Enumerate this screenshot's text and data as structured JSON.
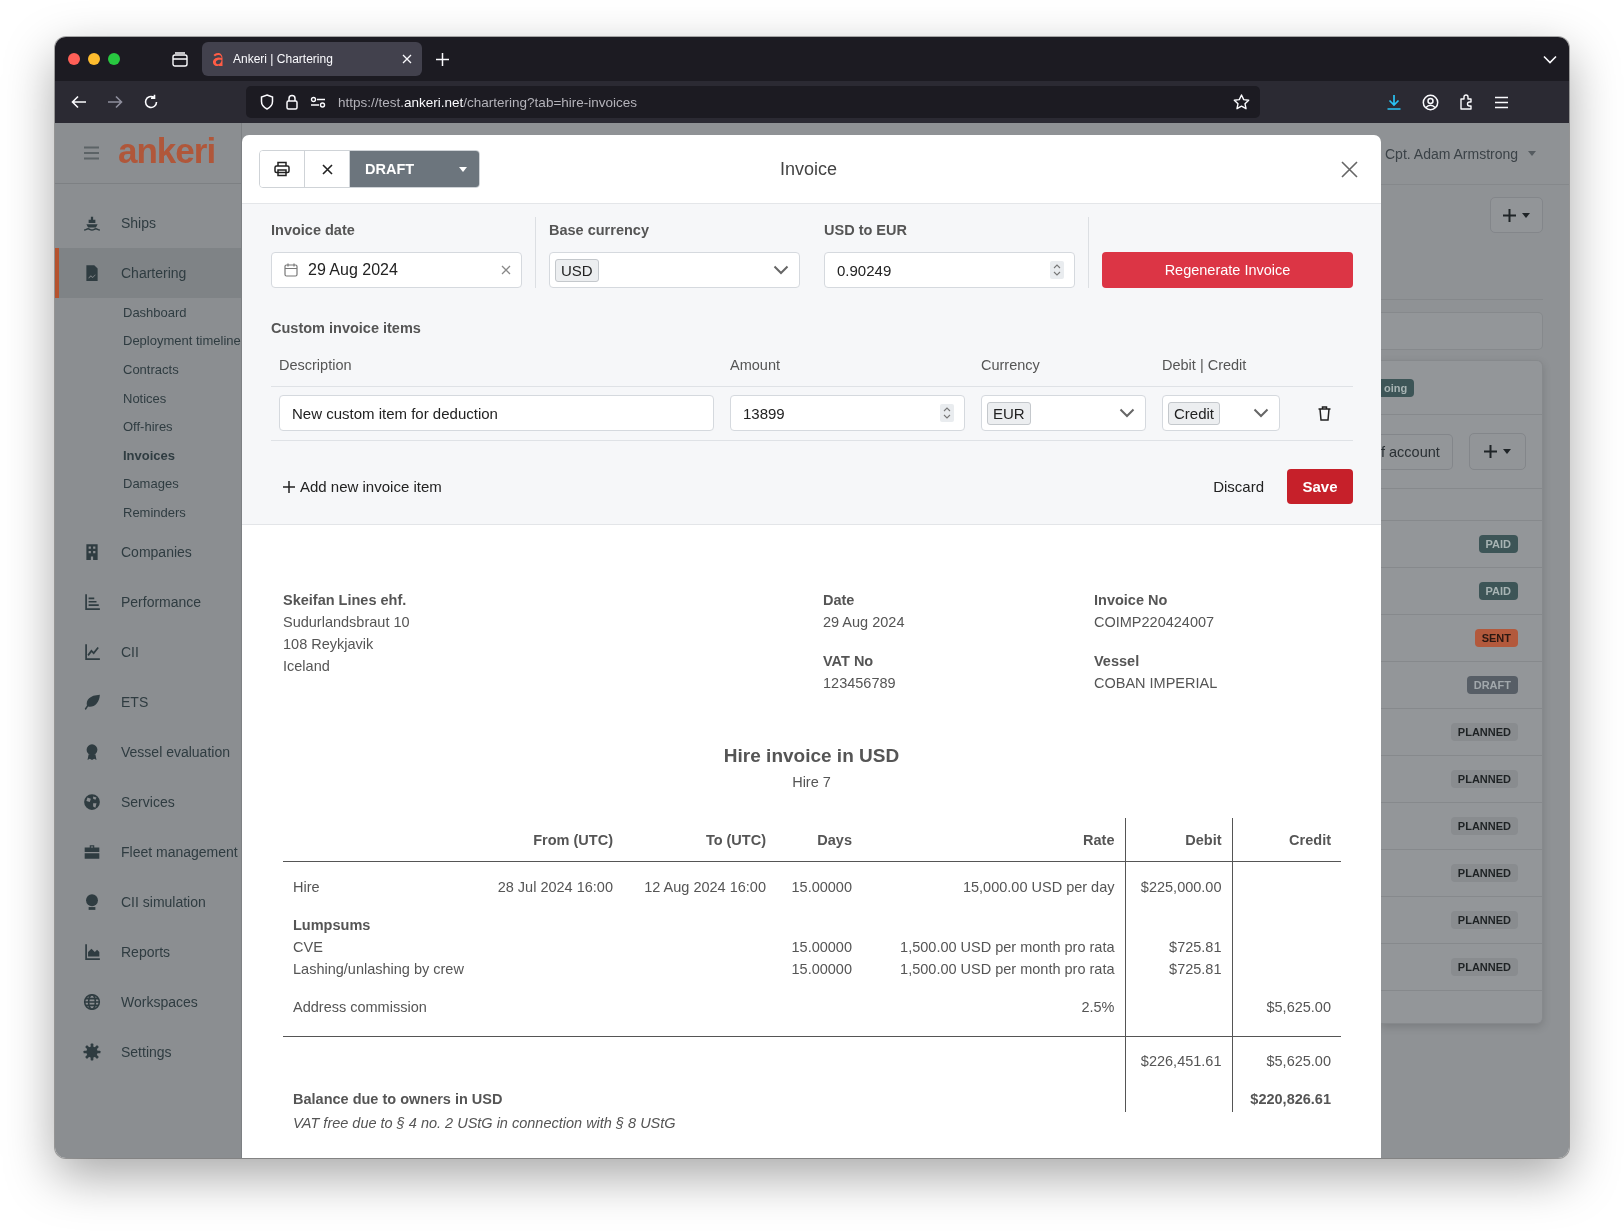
{
  "browser": {
    "tab_title": "Ankeri | Chartering",
    "url": [
      "https://test.",
      "ankeri.net",
      "/chartering?tab=hire-invoices"
    ]
  },
  "app": {
    "logo": "ankeri",
    "user": "Cpt. Adam Armstrong"
  },
  "sidebar": {
    "items": [
      {
        "label": "Ships",
        "selected": false
      },
      {
        "label": "Chartering",
        "selected": true,
        "children": [
          {
            "label": "Dashboard",
            "selected": false
          },
          {
            "label": "Deployment timeline",
            "selected": false
          },
          {
            "label": "Contracts",
            "selected": false
          },
          {
            "label": "Notices",
            "selected": false
          },
          {
            "label": "Off-hires",
            "selected": false
          },
          {
            "label": "Invoices",
            "selected": true
          },
          {
            "label": "Damages",
            "selected": false
          },
          {
            "label": "Reminders",
            "selected": false
          }
        ]
      },
      {
        "label": "Companies",
        "selected": false
      },
      {
        "label": "Performance",
        "selected": false
      },
      {
        "label": "CII",
        "selected": false
      },
      {
        "label": "ETS",
        "selected": false
      },
      {
        "label": "Vessel evaluation",
        "selected": false
      },
      {
        "label": "Services",
        "selected": false
      },
      {
        "label": "Fleet management",
        "selected": false
      },
      {
        "label": "CII simulation",
        "selected": false
      },
      {
        "label": "Reports",
        "selected": false
      },
      {
        "label": "Workspaces",
        "selected": false
      },
      {
        "label": "Settings",
        "selected": false
      }
    ]
  },
  "background": {
    "card_badge": {
      "label": "oing",
      "kind": "ongoing"
    },
    "account_button": "f account",
    "statuses": [
      {
        "label": "PAID",
        "kind": "paid"
      },
      {
        "label": "PAID",
        "kind": "paid"
      },
      {
        "label": "SENT",
        "kind": "sent"
      },
      {
        "label": "DRAFT",
        "kind": "draft"
      },
      {
        "label": "PLANNED",
        "kind": "planned"
      },
      {
        "label": "PLANNED",
        "kind": "planned"
      },
      {
        "label": "PLANNED",
        "kind": "planned"
      },
      {
        "label": "PLANNED",
        "kind": "planned"
      },
      {
        "label": "PLANNED",
        "kind": "planned"
      },
      {
        "label": "PLANNED",
        "kind": "planned"
      }
    ]
  },
  "modal": {
    "status_button": "DRAFT",
    "title": "Invoice",
    "form": {
      "invoice_date": {
        "label": "Invoice date",
        "value": "29 Aug 2024"
      },
      "base_currency": {
        "label": "Base currency",
        "value": "USD"
      },
      "exchange_rate": {
        "label": "USD to EUR",
        "value": "0.90249"
      },
      "regenerate_button": "Regenerate Invoice"
    },
    "custom_items": {
      "title": "Custom invoice items",
      "columns": [
        "Description",
        "Amount",
        "Currency",
        "Debit | Credit"
      ],
      "rows": [
        {
          "description": "New custom item for deduction",
          "amount": "13899",
          "currency": "EUR",
          "debit_credit": "Credit"
        }
      ],
      "add_button": "Add new invoice item",
      "discard_button": "Discard",
      "save_button": "Save"
    }
  },
  "invoice": {
    "owner": {
      "name": "Skeifan Lines ehf.",
      "address": [
        "Sudurlandsbraut 10",
        "108 Reykjavik",
        "Iceland"
      ]
    },
    "details": [
      {
        "label": "Date",
        "value": "29 Aug 2024"
      },
      {
        "label": "Invoice No",
        "value": "COIMP220424007"
      },
      {
        "label": "VAT No",
        "value": "123456789"
      },
      {
        "label": "Vessel",
        "value": "COBAN IMPERIAL"
      }
    ],
    "heading": "Hire invoice in USD",
    "subheading": "Hire 7",
    "table": {
      "columns": [
        "From (UTC)",
        "To (UTC)",
        "Days",
        "Rate",
        "Debit",
        "Credit"
      ],
      "rows": [
        {
          "kind": "item",
          "label": "Hire",
          "from": "28 Jul 2024 16:00",
          "to": "12 Aug 2024 16:00",
          "days": "15.00000",
          "rate": "15,000.00 USD per day",
          "debit": "$225,000.00"
        },
        {
          "kind": "group",
          "label": "Lumpsums"
        },
        {
          "kind": "subitem",
          "label": "CVE",
          "days": "15.00000",
          "rate": "1,500.00 USD per month pro rata",
          "debit": "$725.81"
        },
        {
          "kind": "subitem",
          "label": "Lashing/unlashing by crew",
          "days": "15.00000",
          "rate": "1,500.00 USD per month pro rata",
          "debit": "$725.81"
        },
        {
          "kind": "item",
          "label": "Address commission",
          "rate": "2.5%",
          "credit": "$5,625.00"
        }
      ],
      "totals": {
        "debit": "$226,451.61",
        "credit": "$5,625.00"
      },
      "balance": {
        "label": "Balance due to owners in USD",
        "credit": "$220,826.61"
      }
    },
    "note": "VAT free due to § 4 no. 2 UStG in connection with § 8 UStG"
  }
}
